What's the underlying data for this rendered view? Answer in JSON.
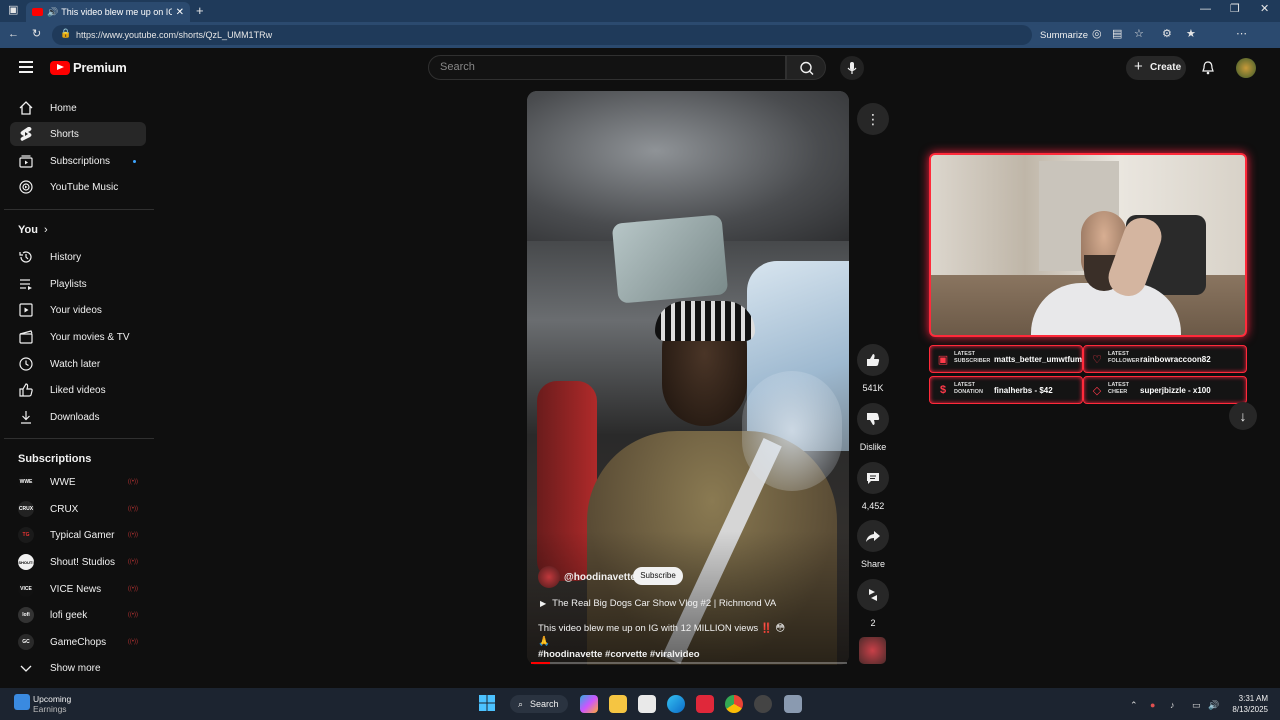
{
  "browser": {
    "tab_title": "This video blew me up on IG",
    "url": "https://www.youtube.com/shorts/QzL_UMM1TRw",
    "summarize_label": "Summarize"
  },
  "header": {
    "logo_text": "Premium",
    "search_placeholder": "Search",
    "create_label": "Create"
  },
  "sidebar": {
    "main": [
      "Home",
      "Shorts",
      "Subscriptions",
      "YouTube Music"
    ],
    "you_title": "You",
    "you_items": [
      "History",
      "Playlists",
      "Your videos",
      "Your movies & TV",
      "Watch later",
      "Liked videos",
      "Downloads"
    ],
    "subs_title": "Subscriptions",
    "subs": [
      {
        "name": "WWE",
        "badge": "WWE",
        "live": "((•))"
      },
      {
        "name": "CRUX",
        "badge": "CRUX",
        "live": "((•))"
      },
      {
        "name": "Typical Gamer",
        "badge": "TG",
        "live": "((•))"
      },
      {
        "name": "Shout! Studios",
        "badge": "SHOUT!",
        "live": "((•))"
      },
      {
        "name": "VICE News",
        "badge": "VICE",
        "live": "((•))"
      },
      {
        "name": "lofi geek",
        "badge": "lofi",
        "live": "((•))"
      },
      {
        "name": "GameChops",
        "badge": "GC",
        "live": "((•))"
      }
    ],
    "show_more": "Show more"
  },
  "short": {
    "channel": "@hoodinavette",
    "subscribe_label": "Subscribe",
    "video_link": "The Real Big Dogs Car Show Vlog #2 | Richmond VA",
    "caption_line1": "This video blew me up on IG with 12 MILLION views ‼️ 😳🙏",
    "caption_line2": "#hoodinavette #corvette #viralvideo",
    "progress": 0.06
  },
  "actions": {
    "likes": "541K",
    "dislike_label": "Dislike",
    "comments": "4,452",
    "share_label": "Share",
    "remix_count": "2"
  },
  "overlay": {
    "latest_subscriber_key": "LATEST SUBSCRIBER",
    "latest_subscriber_value": "matts_better_umwtfum",
    "latest_follower_key": "LATEST FOLLOWER",
    "latest_follower_value": "rainbowraccoon82",
    "latest_donation_key": "LATEST DONATION",
    "latest_donation_value": "finalherbs - $42",
    "latest_cheer_key": "LATEST CHEER",
    "latest_cheer_value": "superjbizzle - x100"
  },
  "taskbar": {
    "widget_title": "Upcoming",
    "widget_sub": "Earnings",
    "search_label": "Search",
    "time": "3:31 AM",
    "date": "8/13/2025"
  },
  "colors": {
    "accent": "#ff0000",
    "overlay_border": "#ff2a3a"
  }
}
